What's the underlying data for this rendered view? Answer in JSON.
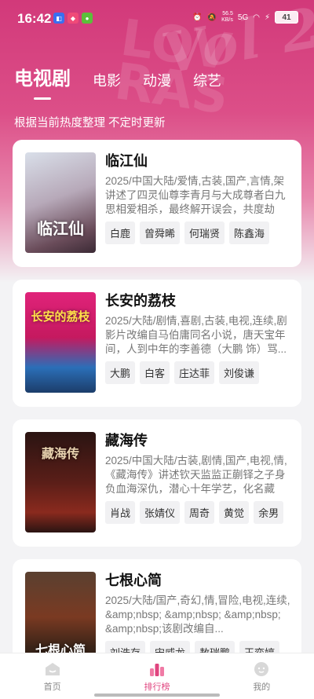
{
  "status": {
    "time": "16:42",
    "net_speed": "56.5",
    "net_unit": "KB/s",
    "signal": "5G",
    "battery": "41"
  },
  "tabs": [
    {
      "label": "电视剧",
      "active": true
    },
    {
      "label": "电影",
      "active": false
    },
    {
      "label": "动漫",
      "active": false
    },
    {
      "label": "综艺",
      "active": false
    }
  ],
  "subtitle": "根据当前热度整理 不定时更新",
  "items": [
    {
      "title": "临江仙",
      "meta": "2025/中国大陆/爱情,古装,国产,言情,架",
      "desc": "讲述了四灵仙尊李青月与大成尊者白九思相爱相杀，最终解开误会，共度劫难...",
      "tags": [
        "白鹿",
        "曾舜晞",
        "何瑞贤",
        "陈鑫海"
      ],
      "poster_text": "临江仙",
      "poster_colors": [
        "#d9dfe9",
        "#8a6e7e",
        "#3b2a35"
      ]
    },
    {
      "title": "长安的荔枝",
      "meta": "2025/大陆/剧情,喜剧,古装,电视,连续,剧",
      "desc": "影片改编自马伯庸同名小说，唐天宝年间，人到中年的李善德（大鹏 饰）骂...",
      "tags": [
        "大鹏",
        "白客",
        "庄达菲",
        "刘俊谦"
      ],
      "poster_text": "长安的荔枝",
      "poster_colors": [
        "#e0237a",
        "#c5195f",
        "#2b6fb8"
      ]
    },
    {
      "title": "藏海传",
      "meta": "2025/中国大陆/古装,剧情,国产,电视,情,",
      "desc": "《藏海传》讲述钦天监监正蒯铎之子身负血海深仇，潜心十年学艺，化名藏海...",
      "tags": [
        "肖战",
        "张婧仪",
        "周奇",
        "黄觉",
        "余男"
      ],
      "poster_text": "藏海传",
      "poster_colors": [
        "#2a1412",
        "#5a1e18",
        "#8a2a1e"
      ]
    },
    {
      "title": "七根心简",
      "meta": "2025/大陆/国产,奇幻,情,冒险,电视,连续,",
      "desc": "&amp;nbsp; &amp;nbsp; &amp;nbsp; &amp;nbsp;该剧改编自...",
      "tags": [
        "刘浩存",
        "宋威龙",
        "敖瑞鹏",
        "王奕婷"
      ],
      "poster_text": "七根心简",
      "poster_colors": [
        "#5a4030",
        "#7a3a22",
        "#201612"
      ]
    }
  ],
  "bottom_nav": [
    {
      "label": "首页",
      "active": false
    },
    {
      "label": "排行榜",
      "active": true
    },
    {
      "label": "我的",
      "active": false
    }
  ]
}
